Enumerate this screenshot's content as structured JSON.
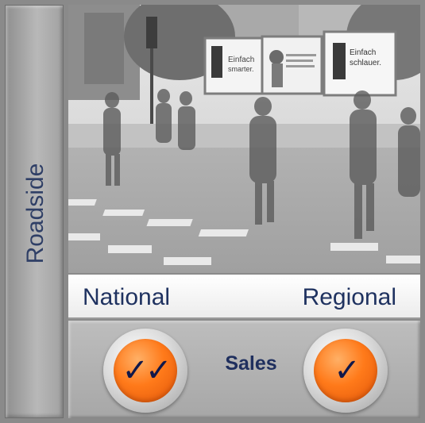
{
  "side": {
    "label": "Roadside"
  },
  "columns": {
    "national": "National",
    "regional": "Regional"
  },
  "center": {
    "label": "Sales"
  },
  "photo": {
    "billboards": [
      {
        "line1": "Einfach",
        "line2": "smarter."
      },
      {
        "line1": "",
        "line2": ""
      },
      {
        "line1": "Einfach",
        "line2": "schlauer."
      }
    ]
  },
  "checks": {
    "national": "✓✓",
    "regional": "✓"
  },
  "icons": {
    "badge": "orange-checkmark-badge-icon"
  },
  "colors": {
    "accent": "#ff7a1a",
    "text": "#1f3260",
    "frame": "#8a8a8a"
  }
}
